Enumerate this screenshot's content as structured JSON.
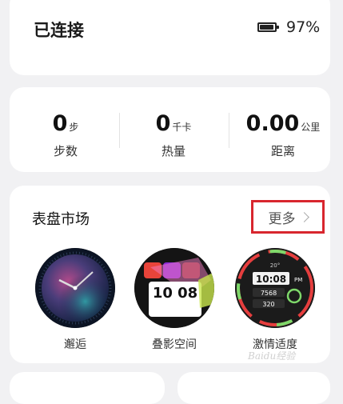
{
  "connection": {
    "status": "已连接",
    "battery_percent": "97%",
    "battery_level": 0.97
  },
  "stats": [
    {
      "value": "0",
      "unit": "步",
      "label": "步数"
    },
    {
      "value": "0",
      "unit": "千卡",
      "label": "热量"
    },
    {
      "value": "0.00",
      "unit": "公里",
      "label": "距离"
    }
  ],
  "market": {
    "title": "表盘市场",
    "more_label": "更多",
    "faces": [
      {
        "name": "邂逅",
        "icon": "watch-face-encounter"
      },
      {
        "name": "叠影空间",
        "icon": "watch-face-overlap-space",
        "time": "10 08"
      },
      {
        "name": "激情适度",
        "icon": "watch-face-passion",
        "time": "10:08",
        "ampm": "PM",
        "num1": "7568",
        "num2": "320",
        "temp": "20°"
      }
    ]
  },
  "colors": {
    "highlight_border": "#d8262e",
    "background": "#f1f1f3",
    "card": "#ffffff"
  },
  "watermark": "Baidu经验"
}
